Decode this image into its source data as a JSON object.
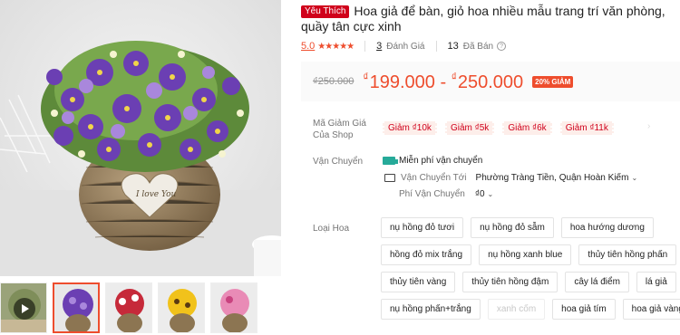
{
  "product": {
    "favorite_badge": "Yêu Thích",
    "title": "Hoa giả để bàn, giỏ hoa nhiều mẫu trang trí văn phòng, quầy tân cực xinh"
  },
  "stats": {
    "rating": "5.0",
    "stars": "★★★★★",
    "reviews_count": "3",
    "reviews_label": "Đánh Giá",
    "sold_count": "13",
    "sold_label": "Đã Bán",
    "help_icon": "question-circle-icon"
  },
  "pricing": {
    "original": "₫250.000",
    "currency": "₫",
    "min": "199.000",
    "separator": "-",
    "max": "250.000",
    "discount": "20% GIẢM"
  },
  "vouchers": {
    "label": "Mã Giảm Giá Của Shop",
    "items": [
      "Giảm ₫10k",
      "Giảm ₫5k",
      "Giảm ₫6k",
      "Giảm ₫11k"
    ]
  },
  "shipping": {
    "label": "Vận Chuyển",
    "free": "Miễn phí vận chuyển",
    "to_label": "Vận Chuyển Tới",
    "to_value": "Phường Tràng Tiền, Quận Hoàn Kiếm",
    "fee_label": "Phí Vận Chuyển",
    "fee_value": "₫0"
  },
  "variants": {
    "label": "Loại Hoa",
    "rows": [
      [
        "nụ hồng đỏ tươi",
        "nụ hồng đỏ sẫm",
        "hoa hướng dương"
      ],
      [
        "hồng đỏ mix trắng",
        "nụ hồng xanh blue",
        "thủy tiên hồng phấn"
      ],
      [
        "thủy tiên vàng",
        "thủy tiên hồng đậm",
        "cây lá điểm",
        "lá giả"
      ],
      [
        "nụ hồng phấn+trắng",
        "xanh cốm",
        "hoa giả tím",
        "hoa giả vàng"
      ]
    ],
    "disabled": [
      "xanh cốm"
    ]
  },
  "colors": {
    "accent": "#ee4d2d",
    "badge": "#d0011b",
    "voucher_bg": "#fdeeea",
    "shipping_icon": "#26aa99"
  }
}
